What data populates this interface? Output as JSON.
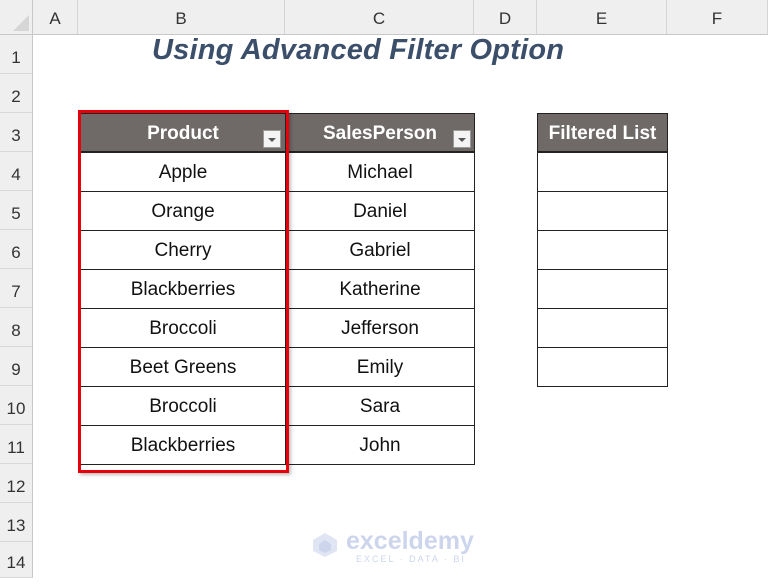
{
  "sheet": {
    "columns": [
      "A",
      "B",
      "C",
      "D",
      "E",
      "F"
    ],
    "rows": [
      "1",
      "2",
      "3",
      "4",
      "5",
      "6",
      "7",
      "8",
      "9",
      "10",
      "11",
      "12",
      "13",
      "14"
    ]
  },
  "title": "Using Advanced Filter Option",
  "data_table": {
    "headers": [
      "Product",
      "SalesPerson"
    ],
    "rows": [
      [
        "Apple",
        "Michael"
      ],
      [
        "Orange",
        "Daniel"
      ],
      [
        "Cherry",
        "Gabriel"
      ],
      [
        "Blackberries",
        "Katherine"
      ],
      [
        "Broccoli",
        "Jefferson"
      ],
      [
        "Beet Greens",
        "Emily"
      ],
      [
        "Broccoli",
        "Sara"
      ],
      [
        "Blackberries",
        "John"
      ]
    ]
  },
  "filtered_list": {
    "header": "Filtered List",
    "rows": [
      "",
      "",
      "",
      "",
      "",
      ""
    ]
  },
  "highlight_color": "#e8000a",
  "header_fill_color": "#6f6a68",
  "watermark": {
    "name": "exceldemy",
    "tagline": "EXCEL · DATA · BI"
  }
}
